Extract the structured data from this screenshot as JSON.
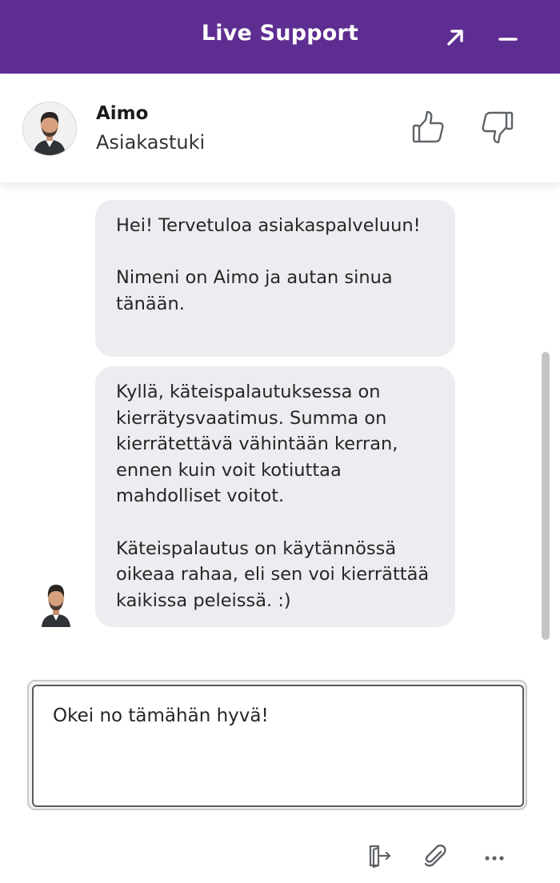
{
  "window": {
    "title": "Live Support"
  },
  "agent": {
    "name": "Aimo",
    "role": "Asiakastuki"
  },
  "messages": [
    {
      "sender": "agent",
      "paragraphs": [
        "Hei! Tervetuloa asiakaspalveluun!",
        "Nimeni on Aimo ja autan sinua tänään."
      ]
    },
    {
      "sender": "agent",
      "paragraphs": [
        "Kyllä, käteispalautuksessa on kierrätysvaatimus. Summa on kierrätettävä vähintään kerran, ennen kuin voit kotiuttaa mahdolliset voitot.",
        "Käteispalautus on käytännössä oikeaa rahaa, eli sen voi kierrättää kaikissa peleissä.  :)"
      ]
    }
  ],
  "composer": {
    "value": "Okei no tämähän hyvä!"
  },
  "icons": {
    "expand": "arrow-up-right-icon",
    "minimize": "minus-icon",
    "like": "thumbs-up-icon",
    "dislike": "thumbs-down-icon",
    "end_chat": "exit-icon",
    "attach": "paperclip-icon",
    "more": "more-icon"
  },
  "colors": {
    "brand": "#5e2d91",
    "bubble": "#ecedf0",
    "icon": "#5f6368"
  }
}
